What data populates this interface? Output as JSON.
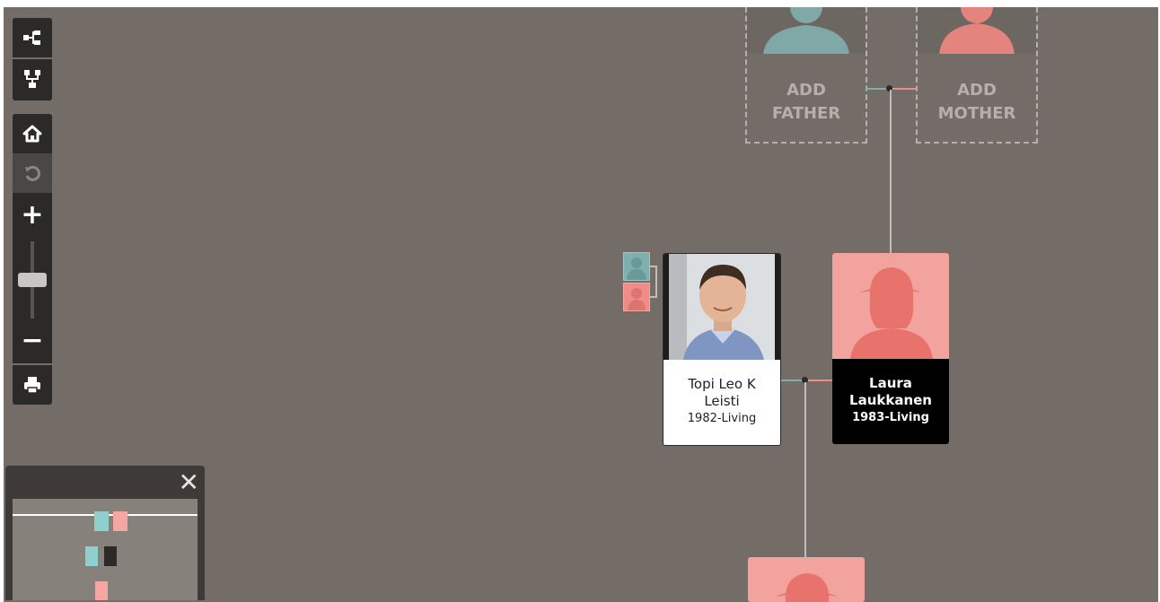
{
  "toolbar": {
    "buttons": [
      {
        "name": "tree-view-button",
        "icon": "tree-horizontal-icon"
      },
      {
        "name": "pedigree-view-button",
        "icon": "tree-vertical-icon"
      },
      {
        "name": "home-button",
        "icon": "home-icon"
      },
      {
        "name": "reset-button",
        "icon": "undo-icon"
      },
      {
        "name": "zoom-in-button",
        "icon": "plus-icon"
      },
      {
        "name": "zoom-out-button",
        "icon": "minus-icon"
      },
      {
        "name": "print-button",
        "icon": "print-icon"
      }
    ],
    "zoom_glyphs": {
      "plus": "+",
      "minus": "−"
    },
    "zoom_level": 0.5
  },
  "add_father": {
    "line1": "ADD",
    "line2": "FATHER"
  },
  "add_mother": {
    "line1": "ADD",
    "line2": "MOTHER"
  },
  "persons": [
    {
      "name_line1": "Topi Leo K",
      "name_line2": "Leisti",
      "dates": "1982-Living",
      "gender": "male",
      "selected": false
    },
    {
      "name_line1": "Laura",
      "name_line2": "Laukkanen",
      "dates": "1983-Living",
      "gender": "female",
      "selected": true
    }
  ],
  "minimap": {
    "close_label": "✕"
  },
  "colors": {
    "canvas": "#736c67",
    "male": "#7fb0af",
    "female": "#ef8c87",
    "female_bg": "#f2a39d",
    "toolbar": "#2b2a29"
  }
}
